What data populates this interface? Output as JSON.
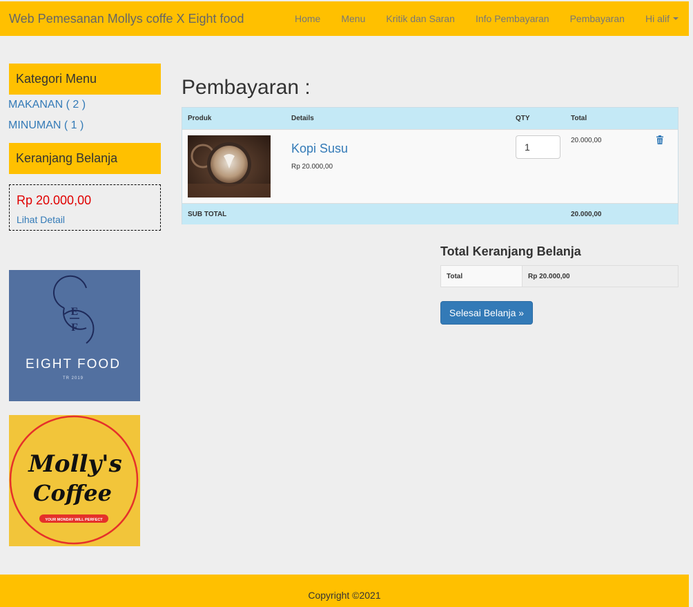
{
  "navbar": {
    "brand": "Web Pemesanan Mollys coffe X Eight food",
    "items": [
      {
        "label": "Home"
      },
      {
        "label": "Menu"
      },
      {
        "label": "Kritik dan Saran"
      },
      {
        "label": "Info Pembayaran"
      },
      {
        "label": "Pembayaran"
      },
      {
        "label": "Hi alif"
      }
    ]
  },
  "sidebar": {
    "category_heading": "Kategori Menu",
    "categories": [
      {
        "label": "MAKANAN ( 2 )"
      },
      {
        "label": "MINUMAN ( 1 )"
      }
    ],
    "cart_heading": "Keranjang Belanja",
    "cart_amount": "Rp 20.000,00",
    "cart_detail_link": "Lihat Detail",
    "logos": {
      "eight_food": {
        "name": "EIGHT FOOD",
        "sub": "TR 2019",
        "monogram_top": "E",
        "monogram_bottom": "F"
      },
      "mollys": {
        "line1": "Molly's",
        "line2": "Coffee",
        "tagline": "YOUR MONDAY WILL PERFECT"
      }
    }
  },
  "main": {
    "title": "Pembayaran :",
    "table": {
      "headers": {
        "product": "Produk",
        "details": "Details",
        "qty": "QTY",
        "total": "Total"
      },
      "rows": [
        {
          "name": "Kopi Susu",
          "price": "Rp 20.000,00",
          "qty": "1",
          "total": "20.000,00"
        }
      ],
      "subtotal_label": "SUB TOTAL",
      "subtotal_value": "20.000,00"
    },
    "summary": {
      "title": "Total Keranjang Belanja",
      "label": "Total",
      "value": "Rp 20.000,00"
    },
    "finish_button": "Selesai Belanja »"
  },
  "footer": {
    "copyright": "Copyright ©2021"
  },
  "colors": {
    "accent": "#ffc000",
    "primary": "#337ab7",
    "table_head": "#c4e9f6",
    "price_red": "#e00000"
  }
}
